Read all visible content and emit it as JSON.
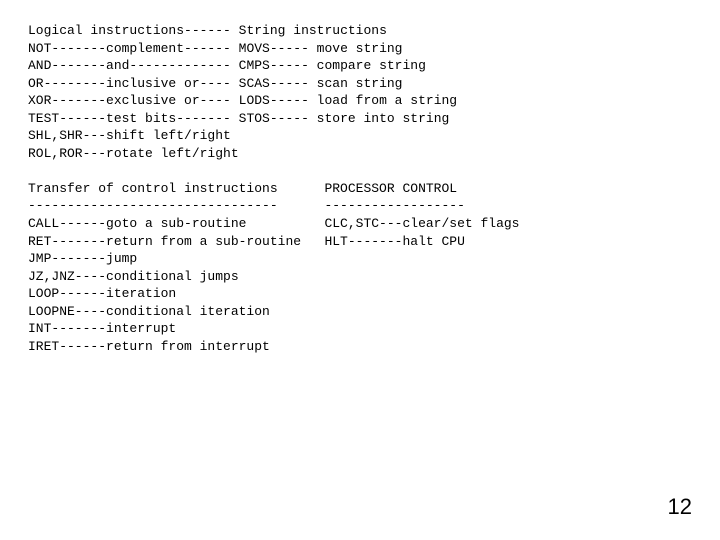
{
  "block1": {
    "l1": "Logical instructions------",
    "l2": "NOT-------complement------",
    "l3": "AND-------and-------------",
    "l4": "OR--------inclusive or----",
    "l5": "XOR-------exclusive or----",
    "l6": "TEST------test bits-------",
    "l7": "SHL,SHR---shift left/right",
    "l8": "ROL,ROR---rotate left/right"
  },
  "block1r": {
    "l1": "String instructions",
    "l2": "MOVS----- move string",
    "l3": "CMPS----- compare string",
    "l4": "SCAS----- scan string",
    "l5": "LODS----- load from a string",
    "l6": "STOS----- store into string"
  },
  "block2": {
    "l1": "Transfer of control instructions",
    "l2": "--------------------------------",
    "l3": "CALL------goto a sub-routine",
    "l4": "RET-------return from a sub-routine",
    "l5": "JMP-------jump",
    "l6": "JZ,JNZ----conditional jumps",
    "l7": "LOOP------iteration",
    "l8": "LOOPNE----conditional iteration",
    "l9": "INT-------interrupt",
    "l10": "IRET------return from interrupt"
  },
  "block2r": {
    "l1": "PROCESSOR CONTROL",
    "l2": "------------------",
    "l3": "CLC,STC---clear/set flags",
    "l4": "HLT-------halt CPU"
  },
  "page_number": "12"
}
